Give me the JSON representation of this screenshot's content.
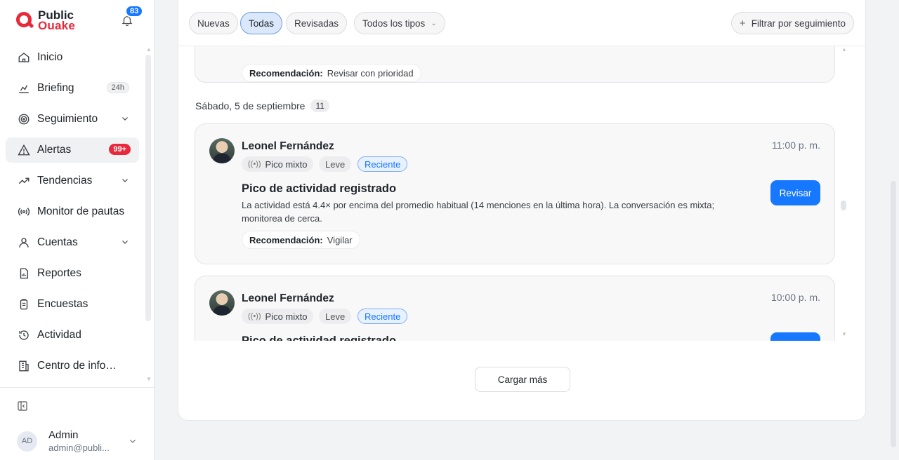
{
  "brand": {
    "line1": "Public",
    "line2": "Ouake"
  },
  "notifications": {
    "count": "83"
  },
  "nav": {
    "items": [
      {
        "label": "Inicio",
        "icon": "home-icon"
      },
      {
        "label": "Briefing",
        "icon": "briefing-icon",
        "pill": "24h"
      },
      {
        "label": "Seguimiento",
        "icon": "target-icon"
      },
      {
        "label": "Alertas",
        "icon": "alert-icon",
        "badge": "99+"
      },
      {
        "label": "Tendencias",
        "icon": "trend-icon"
      },
      {
        "label": "Monitor de pautas",
        "icon": "broadcast-icon"
      },
      {
        "label": "Cuentas",
        "icon": "user-icon"
      },
      {
        "label": "Reportes",
        "icon": "report-icon"
      },
      {
        "label": "Encuestas",
        "icon": "survey-icon"
      },
      {
        "label": "Actividad",
        "icon": "history-icon"
      },
      {
        "label": "Centro de información",
        "icon": "building-icon"
      }
    ]
  },
  "user": {
    "initials": "AD",
    "name": "Admin",
    "email": "admin@publi..."
  },
  "filters": {
    "nuevas": "Nuevas",
    "todas": "Todas",
    "revisadas": "Revisadas",
    "tipos": "Todos los tipos",
    "seguimiento": "Filtrar por seguimiento"
  },
  "prev_card": {
    "reco_label": "Recomendación:",
    "reco_value": "Revisar con prioridad"
  },
  "date_group": {
    "label": "Sábado, 5 de septiembre",
    "count": "11"
  },
  "alerts": [
    {
      "name": "Leonel Fernández",
      "time": "11:00 p. m.",
      "tag_type": "Pico mixto",
      "tag_level": "Leve",
      "tag_status": "Reciente",
      "title": "Pico de actividad registrado",
      "description": "La actividad está 4.4× por encima del promedio habitual (14 menciones en la última hora). La conversación es mixta; monitorea de cerca.",
      "reco_label": "Recomendación:",
      "reco_value": "Vigilar",
      "action": "Revisar"
    },
    {
      "name": "Leonel Fernández",
      "time": "10:00 p. m.",
      "tag_type": "Pico mixto",
      "tag_level": "Leve",
      "tag_status": "Reciente",
      "title": "Pico de actividad registrado",
      "action": "Revisar"
    }
  ],
  "load_more": "Cargar más"
}
